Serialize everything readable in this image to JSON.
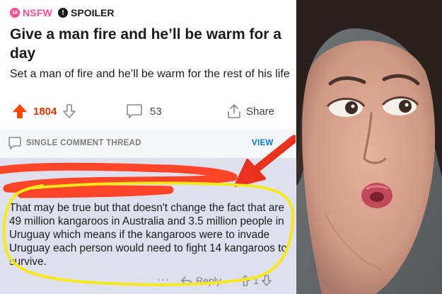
{
  "post": {
    "tags": {
      "nsfw_badge": "18",
      "nsfw_label": "NSFW",
      "spoiler_badge": "!",
      "spoiler_label": "SPOILER"
    },
    "title": "Give a man fire and he’ll be warm for a day",
    "body": "Set a man of fire and he’ll be warm for the rest of his life",
    "score": "1804",
    "comment_count": "53",
    "share_label": "Share",
    "icons": [
      "upvote-arrow-icon",
      "downvote-arrow-icon",
      "comment-bubble-icon",
      "share-icon"
    ]
  },
  "thread_bar": {
    "label": "SINGLE COMMENT THREAD",
    "view_label": "VIEW",
    "icon": "comment-bubble-icon"
  },
  "comment": {
    "text": "That may be true but that doesn't change the fact that are 49 million kangaroos in Australia and 3.5 million people in Uruguay which means if the kangaroos were to invade Uruguay each person would need to fight 14 kangaroos to survive.",
    "more_label": "···",
    "reply_label": "Reply",
    "vote_count": "1"
  },
  "annotations": {
    "scribble_color": "#ff3c1e",
    "arrow_color": "#e8321e",
    "circle_color": "#f5e81c"
  },
  "colors": {
    "nsfw": "#ff4f8b",
    "upvoted": "#d93a00",
    "link": "#0079d3",
    "comment_bg": "#dfe0ee"
  }
}
